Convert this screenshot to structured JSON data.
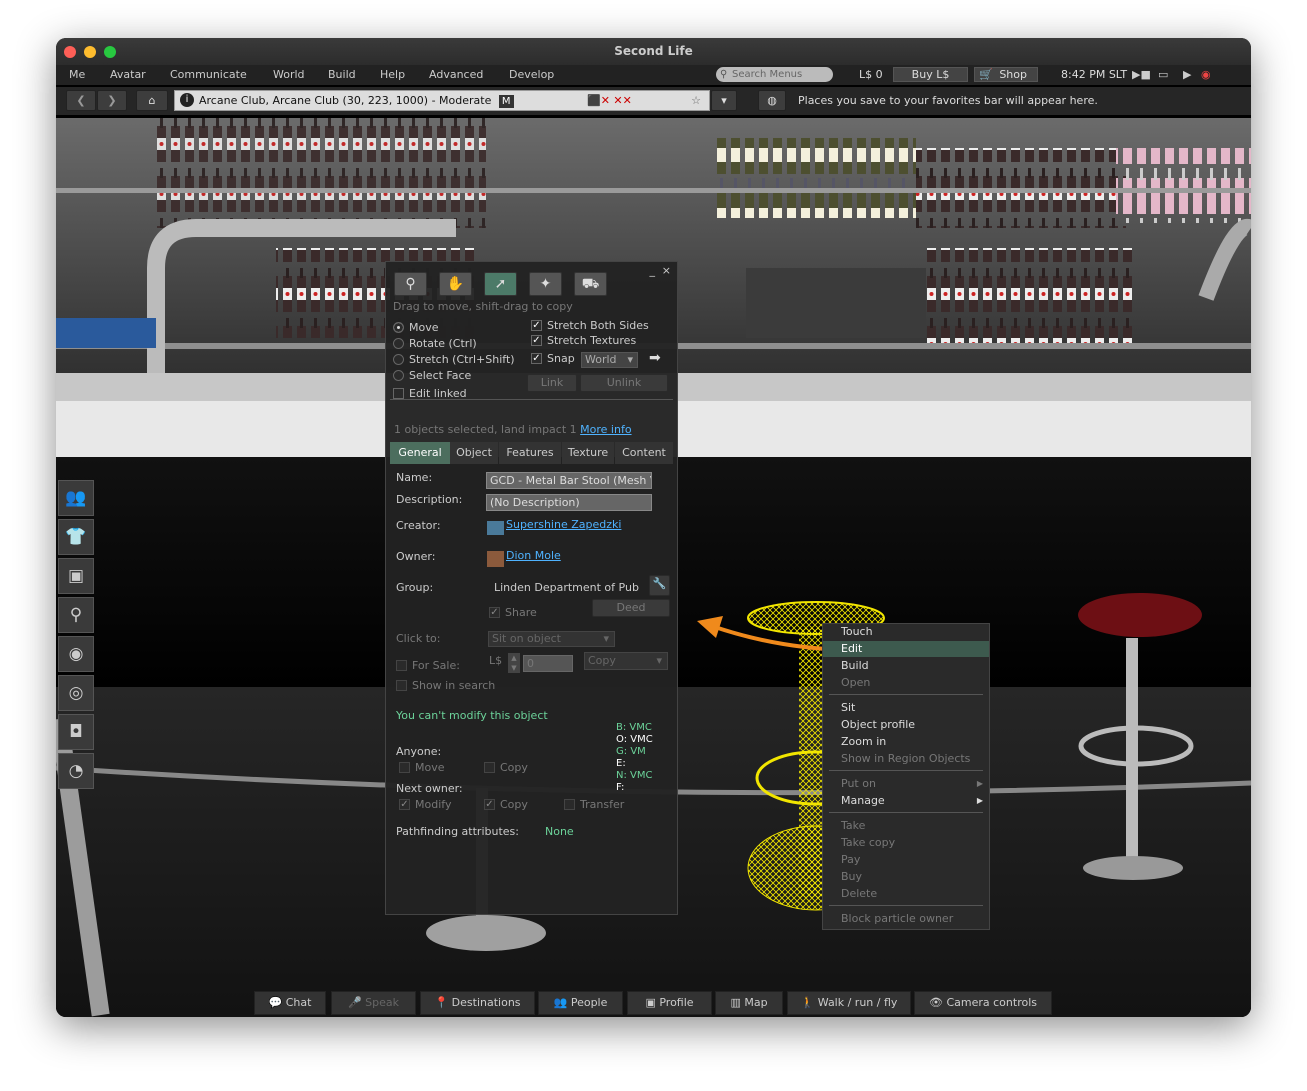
{
  "window": {
    "title": "Second Life"
  },
  "menu": {
    "items": [
      "Me",
      "Avatar",
      "Communicate",
      "World",
      "Build",
      "Help",
      "Advanced",
      "Develop"
    ]
  },
  "status": {
    "search_placeholder": "Search Menus",
    "balance": "L$ 0",
    "buy_label": "Buy L$",
    "shop_label": "Shop",
    "time": "8:42 PM SLT"
  },
  "nav": {
    "location": "Arcane Club, Arcane Club (30, 223, 1000) - Moderate",
    "rating_badge": "M",
    "favorites_hint": "Places you save to your favorites bar will appear here."
  },
  "build": {
    "hint": "Drag to move, shift-drag to copy",
    "tools": [
      "focus-icon",
      "move-hand-icon",
      "edit-pointer-icon",
      "create-wand-icon",
      "land-bulldozer-icon"
    ],
    "modes": [
      "Move",
      "Rotate (Ctrl)",
      "Stretch (Ctrl+Shift)",
      "Select Face"
    ],
    "edit_linked": "Edit linked",
    "stretch_both": "Stretch Both Sides",
    "stretch_textures": "Stretch Textures",
    "snap": "Snap",
    "snap_mode": "World",
    "link": "Link",
    "unlink": "Unlink",
    "selection_info": "1 objects selected, land impact 1",
    "more_info": "More info",
    "tabs": [
      "General",
      "Object",
      "Features",
      "Texture",
      "Content"
    ],
    "name_label": "Name:",
    "name_value": "GCD - Metal Bar Stool (Mesh V",
    "desc_label": "Description:",
    "desc_value": "(No Description)",
    "creator_label": "Creator:",
    "creator": "Supershine Zapedzki",
    "owner_label": "Owner:",
    "owner": "Dion Mole",
    "group_label": "Group:",
    "group": "Linden Department of Pub",
    "share": "Share",
    "deed": "Deed",
    "click_label": "Click to:",
    "click_value": "Sit on object",
    "for_sale": "For Sale:",
    "currency": "L$",
    "price": "0",
    "sale_type": "Copy",
    "show_search": "Show in search",
    "cant_modify": "You can't modify this object",
    "perm_codes": [
      {
        "label": "B:",
        "value": "VMC",
        "color": "green"
      },
      {
        "label": "O:",
        "value": "VMC",
        "color": "white"
      },
      {
        "label": "G:",
        "value": "VM",
        "color": "green"
      },
      {
        "label": "E:",
        "value": "",
        "color": "white"
      },
      {
        "label": "N:",
        "value": "VMC",
        "color": "green"
      },
      {
        "label": "F:",
        "value": "",
        "color": "white"
      }
    ],
    "anyone": "Anyone:",
    "move": "Move",
    "copy": "Copy",
    "next_owner": "Next owner:",
    "modify": "Modify",
    "transfer": "Transfer",
    "pathfinding_label": "Pathfinding attributes:",
    "pathfinding_value": "None"
  },
  "context_menu": {
    "items": [
      {
        "label": "Touch",
        "state": "enabled"
      },
      {
        "label": "Edit",
        "state": "selected"
      },
      {
        "label": "Build",
        "state": "enabled"
      },
      {
        "label": "Open",
        "state": "disabled"
      },
      {
        "label": "Sit",
        "state": "enabled"
      },
      {
        "label": "Object profile",
        "state": "enabled"
      },
      {
        "label": "Zoom in",
        "state": "enabled"
      },
      {
        "label": "Show in Region Objects",
        "state": "disabled"
      },
      {
        "label": "Put on",
        "state": "disabled",
        "submenu": true
      },
      {
        "label": "Manage",
        "state": "enabled",
        "submenu": true
      },
      {
        "label": "Take",
        "state": "disabled"
      },
      {
        "label": "Take copy",
        "state": "disabled"
      },
      {
        "label": "Pay",
        "state": "disabled"
      },
      {
        "label": "Buy",
        "state": "disabled"
      },
      {
        "label": "Delete",
        "state": "disabled"
      },
      {
        "label": "Block particle owner",
        "state": "disabled"
      }
    ]
  },
  "sidebar": {
    "icons": [
      "people-icon",
      "appearance-icon",
      "inventory-icon",
      "search-icon",
      "places-icon",
      "radar-icon",
      "snapshot-icon",
      "performance-icon"
    ]
  },
  "bottombar": {
    "buttons": [
      {
        "label": "Chat",
        "icon": "chat-bubble-icon",
        "enabled": true
      },
      {
        "label": "Speak",
        "icon": "microphone-icon",
        "enabled": false
      },
      {
        "label": "Destinations",
        "icon": "map-pin-icon",
        "enabled": true
      },
      {
        "label": "People",
        "icon": "people-icon",
        "enabled": true
      },
      {
        "label": "Profile",
        "icon": "profile-card-icon",
        "enabled": true
      },
      {
        "label": "Map",
        "icon": "map-icon",
        "enabled": true
      },
      {
        "label": "Walk / run / fly",
        "icon": "walk-icon",
        "enabled": true
      },
      {
        "label": "Camera controls",
        "icon": "eye-icon",
        "enabled": true
      }
    ]
  },
  "colors": {
    "accent_link": "#4fb3ff",
    "selected_bg": "#3d5a4e",
    "highlight_yellow": "#f2e600",
    "arrow_orange": "#f08a1c"
  }
}
